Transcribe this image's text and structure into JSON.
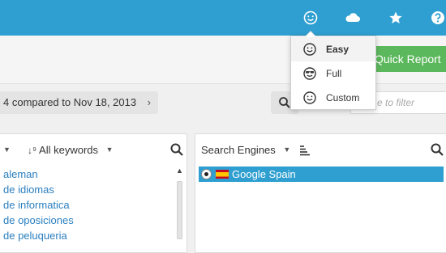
{
  "topbar": {
    "icons": [
      "smiley-icon",
      "cloud-icon",
      "star-icon",
      "help-icon"
    ],
    "bg_color": "#2e9fd0"
  },
  "mode_menu": {
    "items": [
      {
        "label": "Easy",
        "icon": "smiley-icon",
        "selected": true
      },
      {
        "label": "Full",
        "icon": "sunglasses-smiley-icon",
        "selected": false
      },
      {
        "label": "Custom",
        "icon": "smiley-icon",
        "selected": false
      }
    ]
  },
  "toolbar": {
    "quick_report_label": "Quick Report",
    "quick_report_color": "#5cb85c"
  },
  "date_range": {
    "label": "4 compared to Nov 18, 2013",
    "chevron": "›"
  },
  "filter": {
    "placeholder": "e to filter"
  },
  "keywords_panel": {
    "sort_label": "All keywords",
    "sort_icon": "sort-numeric-icon",
    "items": [
      "aleman",
      "de idiomas",
      "de informatica",
      "de oposiciones",
      "de peluqueria"
    ]
  },
  "engines_panel": {
    "header_label": "Search Engines",
    "items": [
      {
        "name": "Google Spain",
        "flag": "spain-flag",
        "selected": true
      }
    ],
    "highlight_color": "#2e9fd0"
  }
}
